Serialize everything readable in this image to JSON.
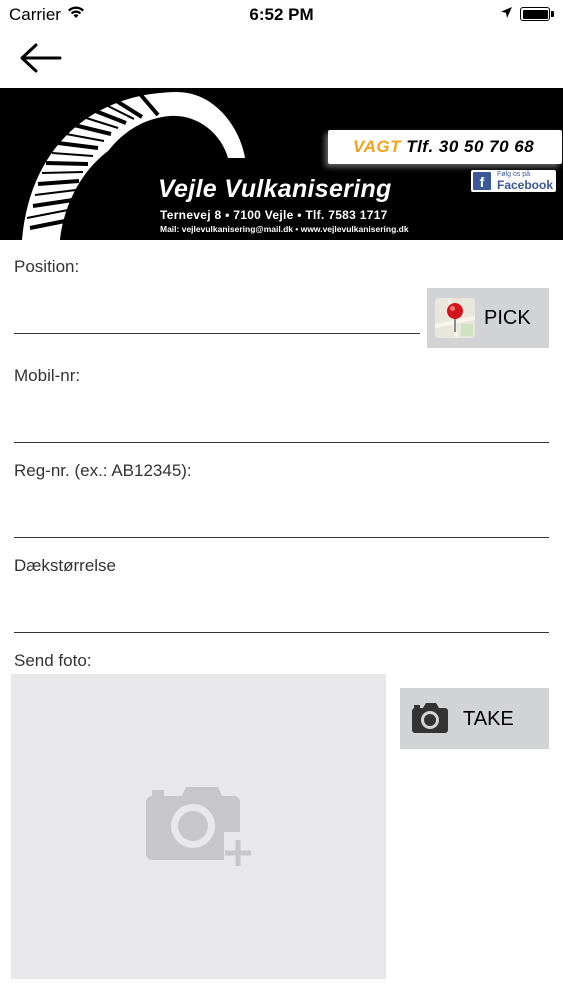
{
  "status_bar": {
    "carrier": "Carrier",
    "time": "6:52 PM"
  },
  "nav": {
    "back_icon": "arrow-left-icon"
  },
  "banner": {
    "vagt_word": "VAGT",
    "vagt_phone": " Tlf. 30 50 70 68",
    "facebook_small": "Følg os på",
    "facebook_name": "Facebook",
    "company_name": "Vejle Vulkanisering",
    "address": "Ternevej 8 • 7100 Vejle • Tlf. 7583 1717",
    "mail": "Mail: vejlevulkanisering@mail.dk • www.vejlevulkanisering.dk",
    "accent_color": "#f5a21b"
  },
  "form": {
    "position": {
      "label": "Position:",
      "value": ""
    },
    "pick_button": {
      "label": "PICK",
      "icon": "map-pin-icon"
    },
    "mobile": {
      "label": "Mobil-nr:",
      "value": ""
    },
    "reg": {
      "label": "Reg-nr. (ex.: AB12345):",
      "value": ""
    },
    "tire_size": {
      "label": "Dækstørrelse",
      "value": ""
    },
    "photo": {
      "label": "Send foto:",
      "placeholder_icon": "add-photo-icon",
      "take_button": {
        "label": "TAKE",
        "icon": "camera-icon"
      }
    }
  },
  "colors": {
    "button_bg": "#d2d3d5",
    "photo_bg": "#e8e8ea"
  }
}
